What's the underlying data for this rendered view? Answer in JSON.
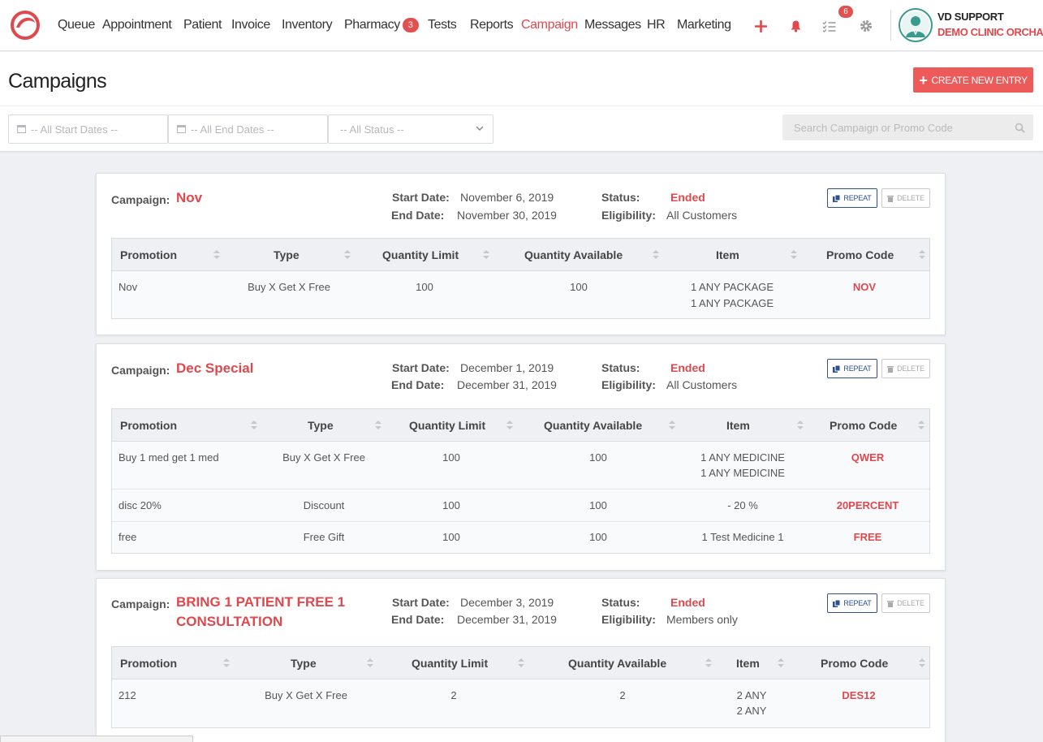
{
  "nav": {
    "items": [
      "Queue",
      "Appointment",
      "Patient",
      "Invoice",
      "Inventory",
      "Pharmacy",
      "Tests",
      "Reports",
      "Campaign",
      "Messages",
      "HR",
      "Marketing"
    ],
    "pharmacy_badge": "3",
    "tasks_badge": "6",
    "active": "Campaign",
    "icons": [
      "plus-icon",
      "bell-icon",
      "checklist-icon",
      "gear-icon"
    ]
  },
  "user": {
    "name": "VD SUPPORT",
    "clinic": "DEMO CLINIC ORCHARD"
  },
  "page": {
    "title": "Campaigns",
    "create_label": "CREATE NEW ENTRY"
  },
  "filters": {
    "start_dates": "-- All Start Dates --",
    "end_dates": "-- All End Dates --",
    "status": "-- All Status --",
    "search_placeholder": "Search Campaign or Promo Code"
  },
  "labels": {
    "campaign": "Campaign:",
    "start_date": "Start Date:",
    "end_date": "End Date:",
    "status": "Status:",
    "eligibility": "Eligibility:",
    "repeat": "REPEAT",
    "delete": "DELETE"
  },
  "columns": [
    "Promotion",
    "Type",
    "Quantity Limit",
    "Quantity Available",
    "Item",
    "Promo Code"
  ],
  "campaigns": [
    {
      "name": "Nov",
      "start_date": "November 6, 2019",
      "end_date": "November 30, 2019",
      "status": "Ended",
      "eligibility": "All Customers",
      "rows": [
        {
          "promotion": "Nov",
          "type": "Buy X Get X Free",
          "limit": "100",
          "available": "100",
          "item": [
            "1 ANY PACKAGE",
            "1 ANY PACKAGE"
          ],
          "code": "NOV"
        }
      ]
    },
    {
      "name": "Dec Special",
      "start_date": "December 1, 2019",
      "end_date": "December 31, 2019",
      "status": "Ended",
      "eligibility": "All Customers",
      "rows": [
        {
          "promotion": "Buy 1 med get 1 med",
          "type": "Buy X Get X Free",
          "limit": "100",
          "available": "100",
          "item": [
            "1 ANY MEDICINE",
            "1 ANY MEDICINE"
          ],
          "code": "QWER"
        },
        {
          "promotion": "disc 20%",
          "type": "Discount",
          "limit": "100",
          "available": "100",
          "item": [
            "- 20 %"
          ],
          "code": "20PERCENT"
        },
        {
          "promotion": "free",
          "type": "Free Gift",
          "limit": "100",
          "available": "100",
          "item": [
            "1 Test Medicine 1"
          ],
          "code": "FREE"
        }
      ]
    },
    {
      "name_lines": [
        "BRING 1 PATIENT FREE 1",
        "CONSULTATION"
      ],
      "start_date": "December 3, 2019",
      "end_date": "December 31, 2019",
      "status": "Ended",
      "eligibility": "Members only",
      "rows": [
        {
          "promotion": "212",
          "type": "Buy X Get X Free",
          "limit": "2",
          "available": "2",
          "item": [
            "2 ANY",
            "2 ANY"
          ],
          "code": "DES12"
        }
      ]
    }
  ]
}
